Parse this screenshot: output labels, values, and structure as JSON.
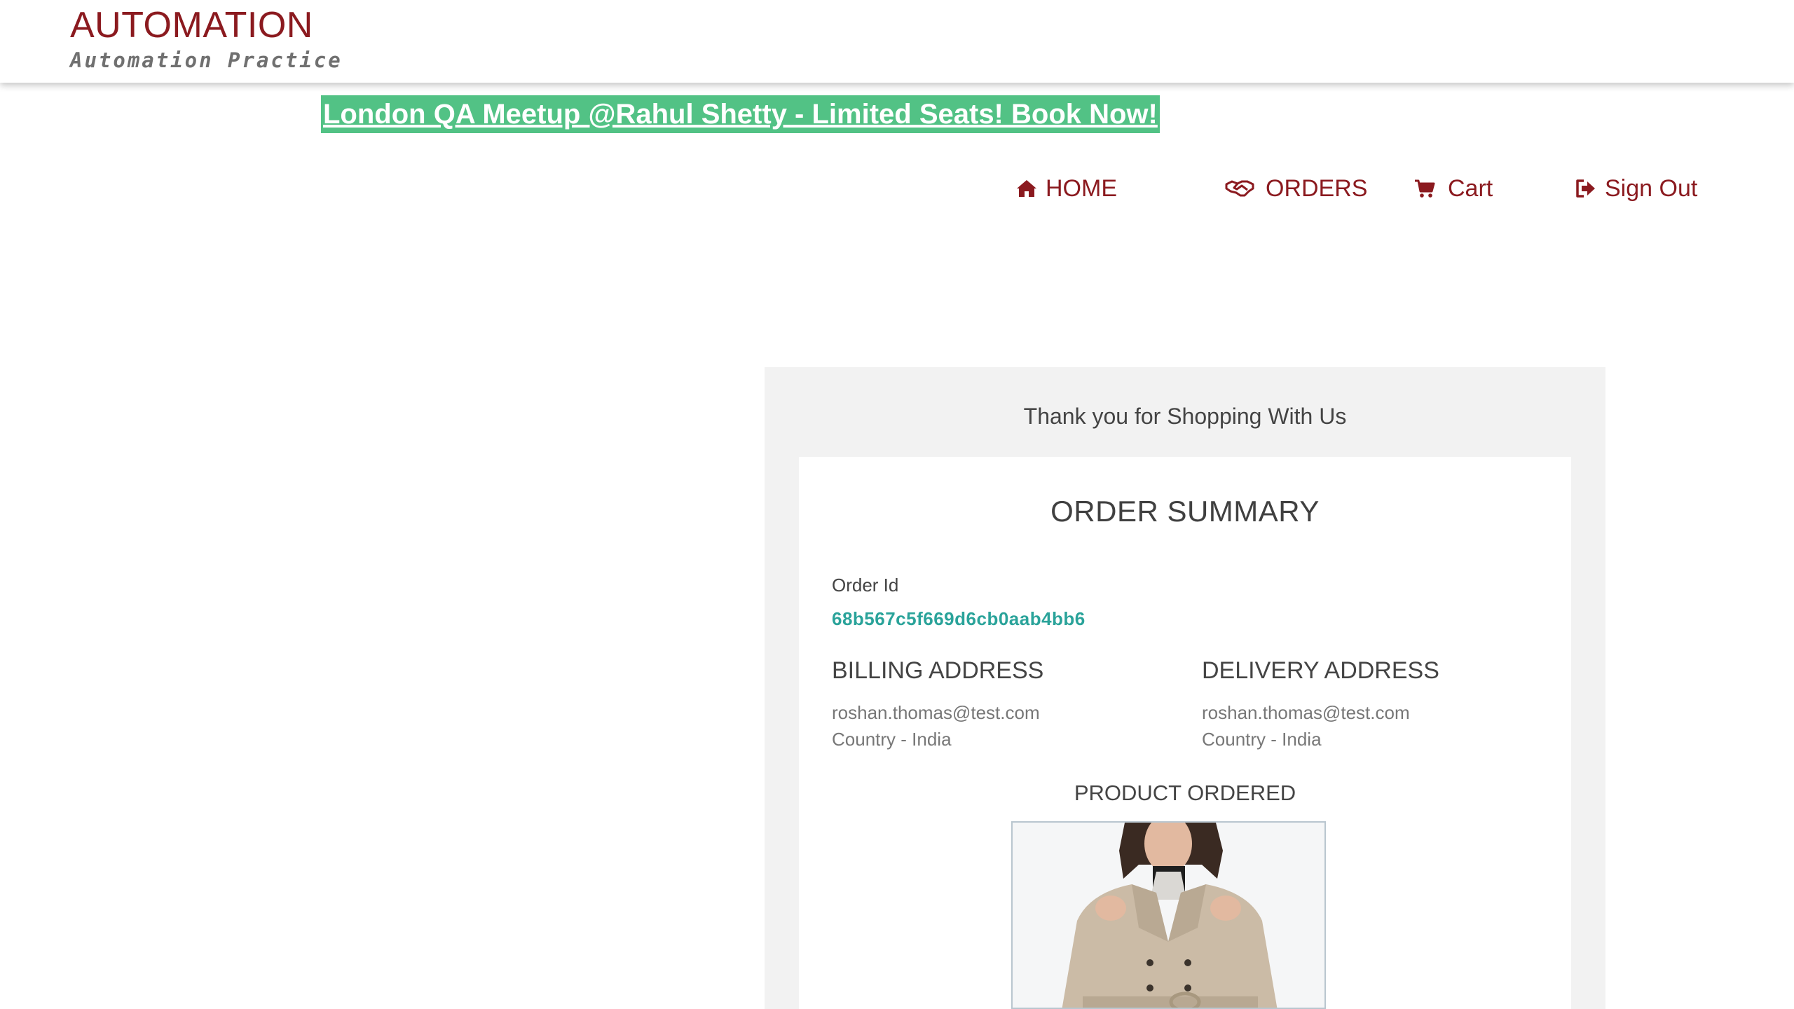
{
  "header": {
    "logo_title": "AUTOMATION",
    "logo_subtitle": "Automation Practice"
  },
  "banner": {
    "text": "London QA Meetup @Rahul Shetty - Limited Seats! Book Now!"
  },
  "nav": {
    "home": {
      "label": "HOME",
      "icon": "home-icon"
    },
    "orders": {
      "label": "ORDERS",
      "icon": "handshake-icon"
    },
    "cart": {
      "label": "Cart",
      "icon": "cart-icon"
    },
    "signout": {
      "label": "Sign Out",
      "icon": "sign-out-icon"
    }
  },
  "order": {
    "thanks": "Thank you for Shopping With Us",
    "summary_title": "ORDER SUMMARY",
    "order_id_label": "Order Id",
    "order_id": "68b567c5f669d6cb0aab4bb6",
    "billing": {
      "heading": "BILLING ADDRESS",
      "email": "roshan.thomas@test.com",
      "country": "Country - India"
    },
    "delivery": {
      "heading": "DELIVERY ADDRESS",
      "email": "roshan.thomas@test.com",
      "country": "Country - India"
    },
    "product_heading": "PRODUCT ORDERED",
    "product_image": "beige-coat-photo"
  },
  "colors": {
    "brand": "#8b1a1f",
    "banner_bg": "#52c285",
    "order_id": "#2aa39a",
    "panel_bg": "#f2f2f2"
  }
}
